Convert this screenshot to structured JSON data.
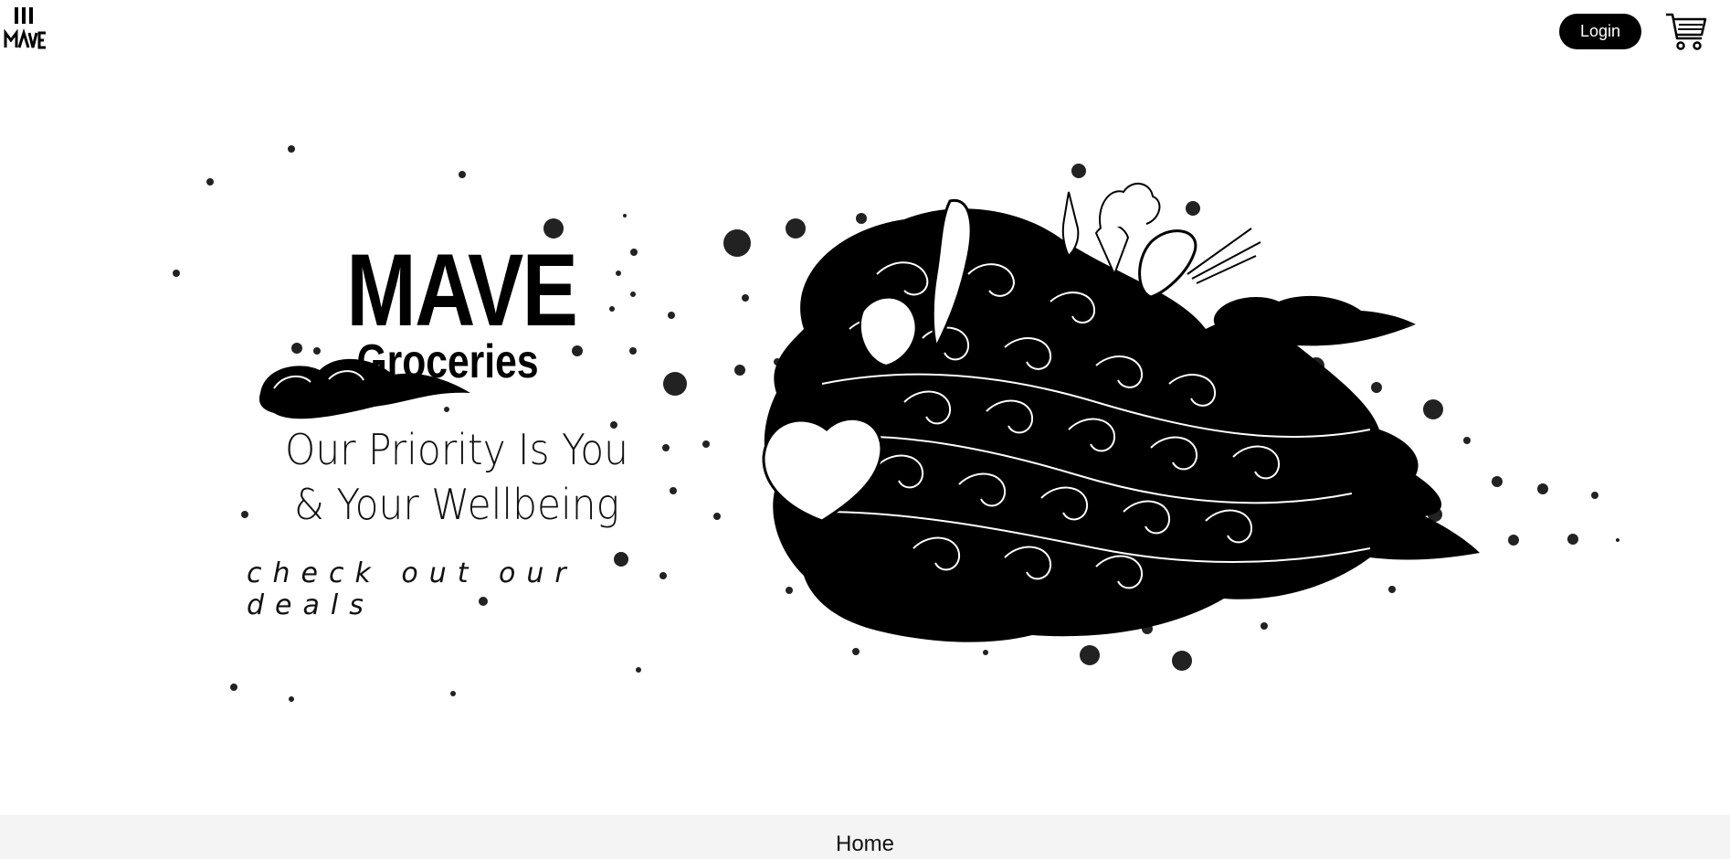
{
  "header": {
    "logo_icon": "mave-logo-icon",
    "login_label": "Login",
    "cart_icon": "shopping-cart-icon"
  },
  "hero": {
    "brand_title": "MAVE",
    "brand_subtitle": "Groceries",
    "tagline_line1": "Our Priority Is You",
    "tagline_line2": "& Your Wellbeing",
    "cta_text": "check out our deals",
    "illustration_icon": "groceries-swirl-illustration"
  },
  "footer": {
    "home_label": "Home"
  },
  "colors": {
    "background": "#ffffff",
    "ink": "#000000",
    "footer_background": "#f4f4f4",
    "button_text": "#ffffff"
  }
}
